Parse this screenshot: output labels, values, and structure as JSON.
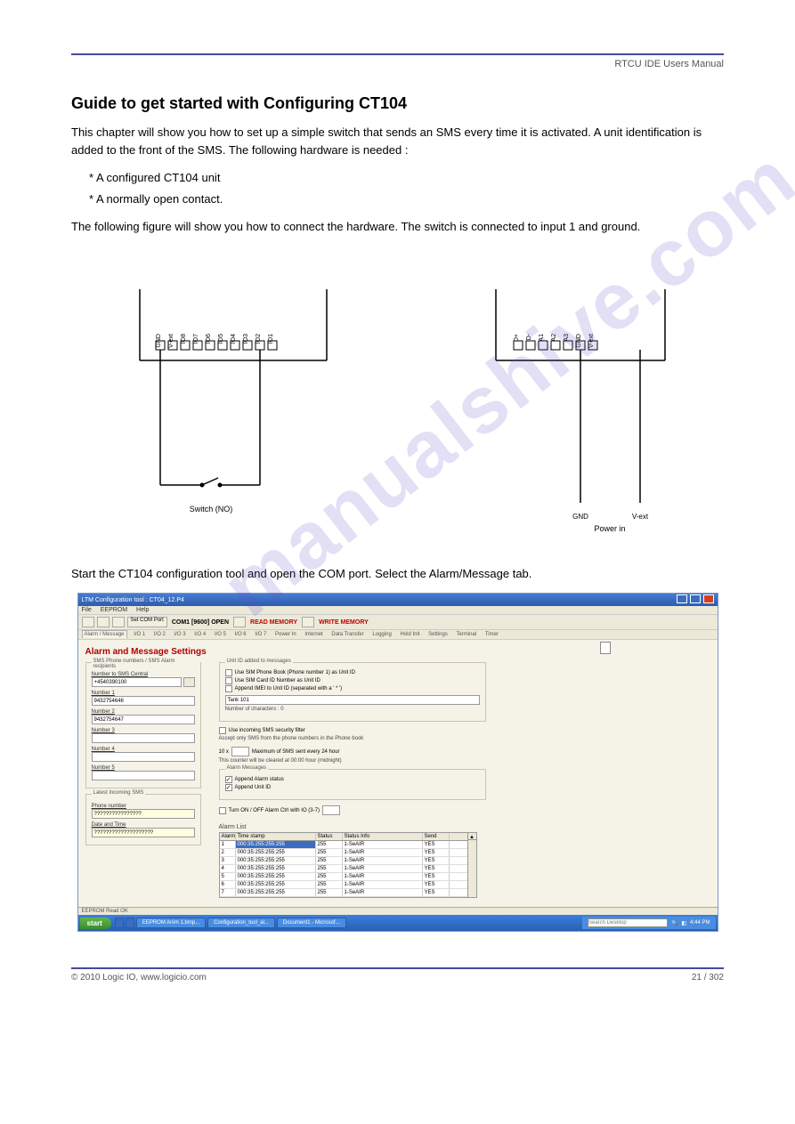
{
  "header": {
    "text": "RTCU IDE Users Manual"
  },
  "title": "Guide to get started with Configuring CT104",
  "intro": "This chapter will show you how to set up a simple switch that sends an SMS every time it is activated. A unit identification is added to the front of the SMS. The following hardware is needed :",
  "hw_list": [
    "* A configured CT104 unit",
    "* A normally open contact."
  ],
  "hw_text": "The following figure will show you how to connect the hardware. The switch is connected to input 1 and ground.",
  "diagram_labels": {
    "switch": "Switch (NO)",
    "gnd": "GND",
    "vext": "V-ext",
    "io1": "IO1",
    "io2_8": [
      "IO2",
      "IO3",
      "IO4",
      "IO5",
      "IO6",
      "IO7",
      "IO8"
    ],
    "d_plus": "D+",
    "d_minus": "D-",
    "a1": "A1",
    "a2": "A2",
    "a3": "A3",
    "gnd2": "GND",
    "vext2": "V-ext",
    "gnd_power": "GND",
    "vext_power": "V-ext",
    "power_in": "Power in"
  },
  "config_text": "Start the CT104 configuration tool and open the COM port. Select the Alarm/Message tab.",
  "screenshot": {
    "window_title": "LTM Configuration tool : CT04_12.P4",
    "menus": [
      "File",
      "EEPROM",
      "Help"
    ],
    "toolbar": {
      "btn_labels": [
        "Set COM Port"
      ],
      "com_status": "COM1 [9600] OPEN",
      "read_mem": "READ MEMORY",
      "write_mem": "WRITE MEMORY"
    },
    "tabs": [
      "Alarm / Message",
      "I/O 1",
      "I/O 2",
      "I/O 3",
      "I/O 4",
      "I/O 5",
      "I/O 6",
      "I/O 7",
      "Power In",
      "Internet",
      "Data Transfer",
      "Logging",
      "Hold Init",
      "Settings",
      "Terminal",
      "Timer"
    ],
    "section_title": "Alarm and Message Settings",
    "left_panel": {
      "legend": "SMS Phone numbers / SMS Alarm recipients",
      "central_label": "Number to SMS Central",
      "central_value": "+4540390100",
      "numbers": [
        {
          "label": "Number 1",
          "value": "9432754646"
        },
        {
          "label": "Number 2",
          "value": "9432754647"
        },
        {
          "label": "Number 3",
          "value": ""
        },
        {
          "label": "Number 4",
          "value": ""
        },
        {
          "label": "Number 5",
          "value": ""
        }
      ]
    },
    "latest_panel": {
      "legend": "Latest incoming SMS",
      "phone_label": "Phone number",
      "phone_value": "????????????????",
      "date_label": "Date and Time",
      "date_value": "????????????????????"
    },
    "unitid_panel": {
      "legend": "Unit ID added to messages",
      "opts": [
        {
          "label": "Use SIM Phone Book (Phone number 1) as Unit ID",
          "checked": false
        },
        {
          "label": "Use SIM Card ID Number as Unit ID",
          "checked": false
        },
        {
          "label": "Append IMEI to Unit ID (separated with a ' * ')",
          "checked": false
        }
      ],
      "unitid_value": "Tank 101",
      "chars_label": "Number of characters : 0"
    },
    "filter": {
      "opt": "Use incoming SMS security filter",
      "note": "Accept only SMS from the phone numbers in the Phone book"
    },
    "limiter": {
      "value": "10 x",
      "label": "Maximum of SMS sent every 24 hour",
      "note": "This counter will be cleared at 00:00 hour (midnight)"
    },
    "alarm_msg_panel": {
      "legend": "Alarm Messages",
      "opts": [
        {
          "label": "Append Alarm status",
          "checked": true
        },
        {
          "label": "Append Unit ID",
          "checked": true
        }
      ]
    },
    "onoff": {
      "label": "Turn ON / OFF Alarm Ctrl with IO (3-7)",
      "value": ""
    },
    "alarm_list": {
      "title": "Alarm List",
      "headers": [
        "Alarm",
        "Time stamp",
        "Status",
        "Status Info",
        "Send"
      ],
      "rows": [
        {
          "n": "1",
          "ts": "000:35:255:255:255",
          "st": "255",
          "info": "1-SeAIR",
          "send": "YES",
          "sel": true
        },
        {
          "n": "2",
          "ts": "000:35:255:255:255",
          "st": "255",
          "info": "1-SeAIR",
          "send": "YES"
        },
        {
          "n": "3",
          "ts": "000:35:255:255:255",
          "st": "255",
          "info": "1-SeAIR",
          "send": "YES"
        },
        {
          "n": "4",
          "ts": "000:35:255:255:255",
          "st": "255",
          "info": "1-SeAIR",
          "send": "YES"
        },
        {
          "n": "5",
          "ts": "000:35:255:255:255",
          "st": "255",
          "info": "1-SeAIR",
          "send": "YES"
        },
        {
          "n": "6",
          "ts": "000:35:255:255:255",
          "st": "255",
          "info": "1-SeAIR",
          "send": "YES"
        },
        {
          "n": "7",
          "ts": "000:35:255:255:255",
          "st": "255",
          "info": "1-SeAIR",
          "send": "YES"
        }
      ]
    },
    "status_bar": "EEPROM Read OK",
    "taskbar": {
      "start": "start",
      "items": [
        "EEPROM Anim 1.bmp...",
        "Configuration_tool_al...",
        "Document1 - Microsof..."
      ],
      "search_placeholder": "Search Desktop",
      "clock": "4:44 PM"
    }
  },
  "watermark": "manualshive.com",
  "footer": {
    "copyright": "© 2010 Logic IO, www.logicio.com",
    "page": "21 / 302"
  }
}
